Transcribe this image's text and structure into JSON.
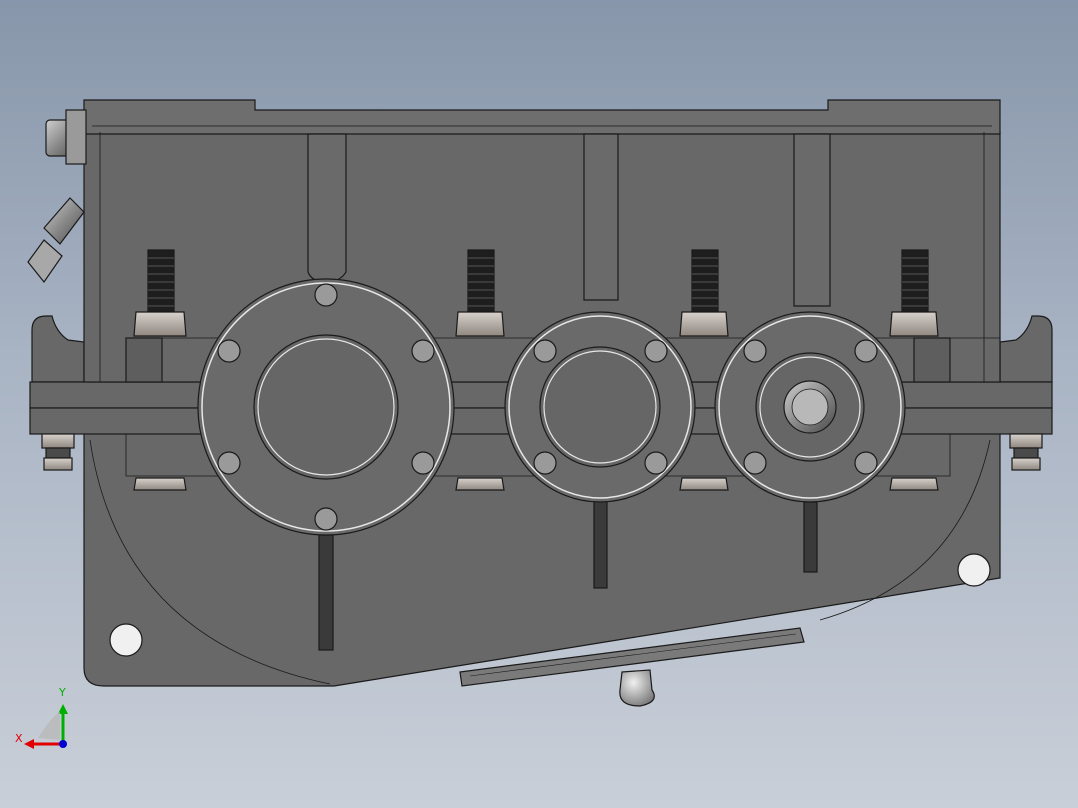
{
  "view": {
    "background_top": "#8796aa",
    "background_bottom": "#c9cfd8",
    "model_color": "#686868",
    "edge_color": "#1a1a1a",
    "shaft_bearings": 3,
    "housing_bolts": 4
  },
  "triad": {
    "x_label": "X",
    "y_label": "Y",
    "x_color": "#e00000",
    "y_color": "#00b000",
    "z_color": "#0000d0"
  }
}
